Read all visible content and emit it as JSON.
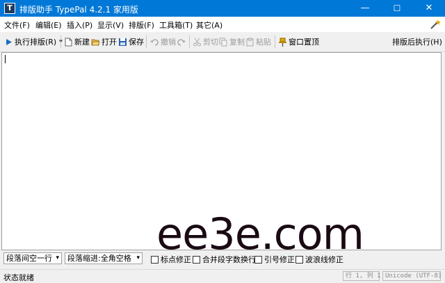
{
  "window": {
    "title": "排版助手 TypePal 4.2.1 家用版",
    "minimize": "—",
    "maximize": "☐",
    "close": "✕"
  },
  "menu": [
    {
      "label": "文件(F)"
    },
    {
      "label": "编辑(E)"
    },
    {
      "label": "插入(P)"
    },
    {
      "label": "显示(V)"
    },
    {
      "label": "排版(F)"
    },
    {
      "label": "工具箱(T)"
    },
    {
      "label": "其它(A)"
    }
  ],
  "toolbar": {
    "run": "执行排版(R)",
    "run_dropdown": "▾",
    "new": "新建",
    "open": "打开",
    "save": "保存",
    "undo": "撤销",
    "cut": "剪切",
    "copy": "复制",
    "paste": "粘贴",
    "pin": "窗口置顶",
    "after_run": "排版后执行(H)",
    "after_run_dropdown": "▾"
  },
  "options": {
    "paragraph_spacing": "段落间空一行",
    "paragraph_indent": "段落缩进:全角空格",
    "checks": [
      {
        "label": "标点修正"
      },
      {
        "label": "合并段字数换行"
      },
      {
        "label": "引号修正"
      },
      {
        "label": "波浪线修正"
      }
    ]
  },
  "status": {
    "text": "状态就绪",
    "position": "行 1, 列 1",
    "encoding": "Unicode (UTF-8)"
  },
  "watermark": "ee3e.com",
  "colors": {
    "titlebar": "#0078d7",
    "background": "#f0f0f0",
    "editor": "#ffffff"
  }
}
